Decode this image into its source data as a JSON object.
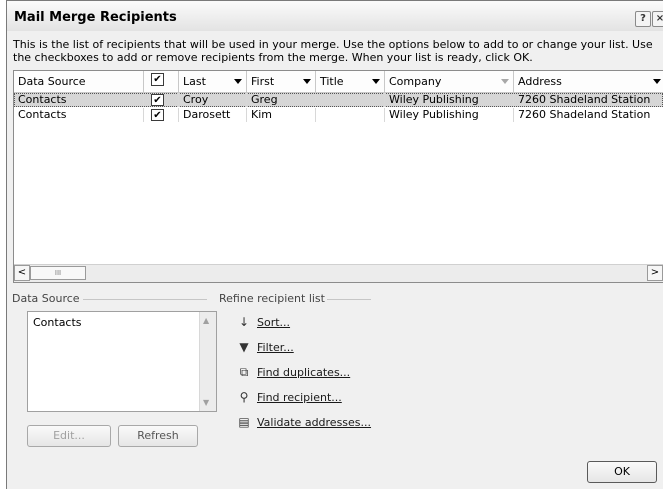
{
  "window": {
    "title": "Mail Merge Recipients",
    "help_glyph": "?",
    "close_glyph": "×"
  },
  "description": "This is the list of recipients that will be used in your merge.  Use the options below to add to or change your list.  Use the checkboxes to add or remove recipients from the merge.  When your list is ready, click OK.",
  "grid": {
    "columns": [
      {
        "label": "Data Source",
        "dropdown": false
      },
      {
        "label": "✔",
        "dropdown": false
      },
      {
        "label": "Last",
        "dropdown": true
      },
      {
        "label": "First",
        "dropdown": true
      },
      {
        "label": "Title",
        "dropdown": true
      },
      {
        "label": "Company",
        "dropdown": true
      },
      {
        "label": "Address",
        "dropdown": true
      }
    ],
    "rows": [
      {
        "source": "Contacts",
        "checked": "✔",
        "last": "Croy",
        "first": "Greg",
        "title": "",
        "company": "Wiley Publishing",
        "address": "7260 Shadeland Station"
      },
      {
        "source": "Contacts",
        "checked": "✔",
        "last": "Darosett",
        "first": "Kim",
        "title": "",
        "company": "Wiley Publishing",
        "address": "7260 Shadeland Station"
      }
    ],
    "scroll_left": "<",
    "scroll_right": ">",
    "scroll_grip": "III"
  },
  "data_source_section": {
    "label": "Data Source",
    "items": [
      "Contacts"
    ],
    "edit_label": "Edit...",
    "refresh_label": "Refresh"
  },
  "refine_section": {
    "label": "Refine recipient list",
    "links": [
      {
        "label": "Sort...",
        "icon": "sort-az-icon",
        "glyph": "↓"
      },
      {
        "label": "Filter...",
        "icon": "filter-icon",
        "glyph": "▼"
      },
      {
        "label": "Find duplicates...",
        "icon": "find-duplicates-icon",
        "glyph": "⧉"
      },
      {
        "label": "Find recipient...",
        "icon": "find-recipient-icon",
        "glyph": "⚲"
      },
      {
        "label": "Validate addresses...",
        "icon": "validate-addresses-icon",
        "glyph": "▤"
      }
    ]
  },
  "ok_label": "OK"
}
